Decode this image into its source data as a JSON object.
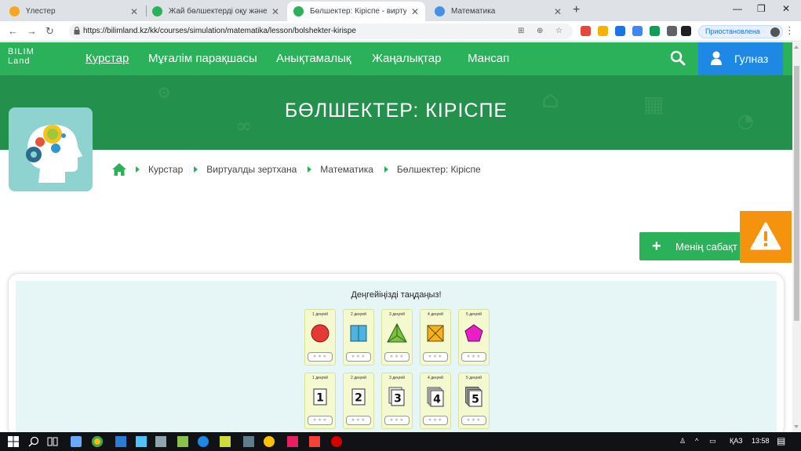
{
  "browser": {
    "tabs": [
      {
        "title": "Үлестер",
        "active": false
      },
      {
        "title": "Жай бөлшектерді оқу және жаз",
        "active": false
      },
      {
        "title": "Бөлшектер: Кіріспе - виртуалды",
        "active": true
      },
      {
        "title": "Математика",
        "active": false
      }
    ],
    "url": "https://bilimland.kz/kk/courses/simulation/matematika/lesson/bolshekter-kirispe",
    "profile_status": "Приостановлена"
  },
  "site": {
    "logo_line1": "BILIM",
    "logo_line2": "Land",
    "nav": [
      "Курстар",
      "Мұғалім парақшасы",
      "Анықтамалық",
      "Жаңалықтар",
      "Мансап"
    ],
    "active_nav": "Курстар",
    "user_name": "Гулназ",
    "brand_green": "#2ab159",
    "user_blue": "#1e88e5"
  },
  "page": {
    "title": "БӨЛШЕКТЕР: КІРІСПЕ",
    "breadcrumb": [
      "Курстар",
      "Виртуалды зертхана",
      "Математика",
      "Бөлшектер: Кіріспе"
    ],
    "my_lessons": "Менің сабақт",
    "alert_color": "#f5930e"
  },
  "simulation": {
    "heading": "Деңгейіңізді таңдаңыз!",
    "row1": [
      {
        "level": "1 деңгей",
        "shape": "circle"
      },
      {
        "level": "2 деңгей",
        "shape": "square"
      },
      {
        "level": "3 деңгей",
        "shape": "triangle"
      },
      {
        "level": "4 деңгей",
        "shape": "crossed-square"
      },
      {
        "level": "5 деңгей",
        "shape": "pentagon"
      }
    ],
    "row2": [
      {
        "level": "1 деңгей",
        "number": "1"
      },
      {
        "level": "2 деңгей",
        "number": "2"
      },
      {
        "level": "3 деңгей",
        "number": "3"
      },
      {
        "level": "4 деңгей",
        "number": "4"
      },
      {
        "level": "5 деңгей",
        "number": "5"
      }
    ],
    "stars": "★★★"
  },
  "taskbar": {
    "lang": "ҚАЗ",
    "time": "13:58"
  }
}
